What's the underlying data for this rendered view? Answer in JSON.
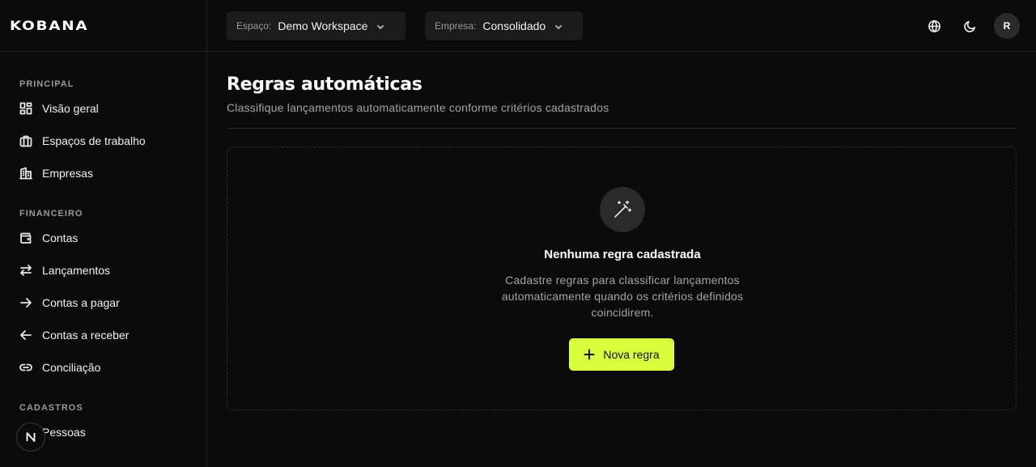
{
  "brand": {
    "logo_text": "KOBANA"
  },
  "sidebar": {
    "sections": [
      {
        "title": "PRINCIPAL",
        "items": [
          {
            "label": "Visão geral",
            "icon": "grid-icon"
          },
          {
            "label": "Espaços de trabalho",
            "icon": "briefcase-icon"
          },
          {
            "label": "Empresas",
            "icon": "building-icon"
          }
        ]
      },
      {
        "title": "FINANCEIRO",
        "items": [
          {
            "label": "Contas",
            "icon": "wallet-icon"
          },
          {
            "label": "Lançamentos",
            "icon": "arrows-left-right-icon"
          },
          {
            "label": "Contas a pagar",
            "icon": "arrow-right-icon"
          },
          {
            "label": "Contas a receber",
            "icon": "arrow-left-icon"
          },
          {
            "label": "Conciliação",
            "icon": "link-icon"
          }
        ]
      },
      {
        "title": "CADASTROS",
        "items": [
          {
            "label": "Pessoas",
            "icon": "users-icon"
          }
        ]
      }
    ]
  },
  "header": {
    "workspace": {
      "label": "Espaço:",
      "value": "Demo Workspace"
    },
    "company": {
      "label": "Empresa:",
      "value": "Consolidado"
    },
    "avatar_initial": "R"
  },
  "page": {
    "title": "Regras automáticas",
    "subtitle": "Classifique lançamentos automaticamente conforme critérios cadastrados"
  },
  "empty_state": {
    "icon": "magic-wand-icon",
    "title": "Nenhuma regra cadastrada",
    "description": "Cadastre regras para classificar lançamentos automaticamente quando os critérios definidos coincidirem.",
    "button_label": "Nova regra"
  },
  "colors": {
    "accent": "#d8ff3c",
    "background": "#0b0b0b"
  }
}
